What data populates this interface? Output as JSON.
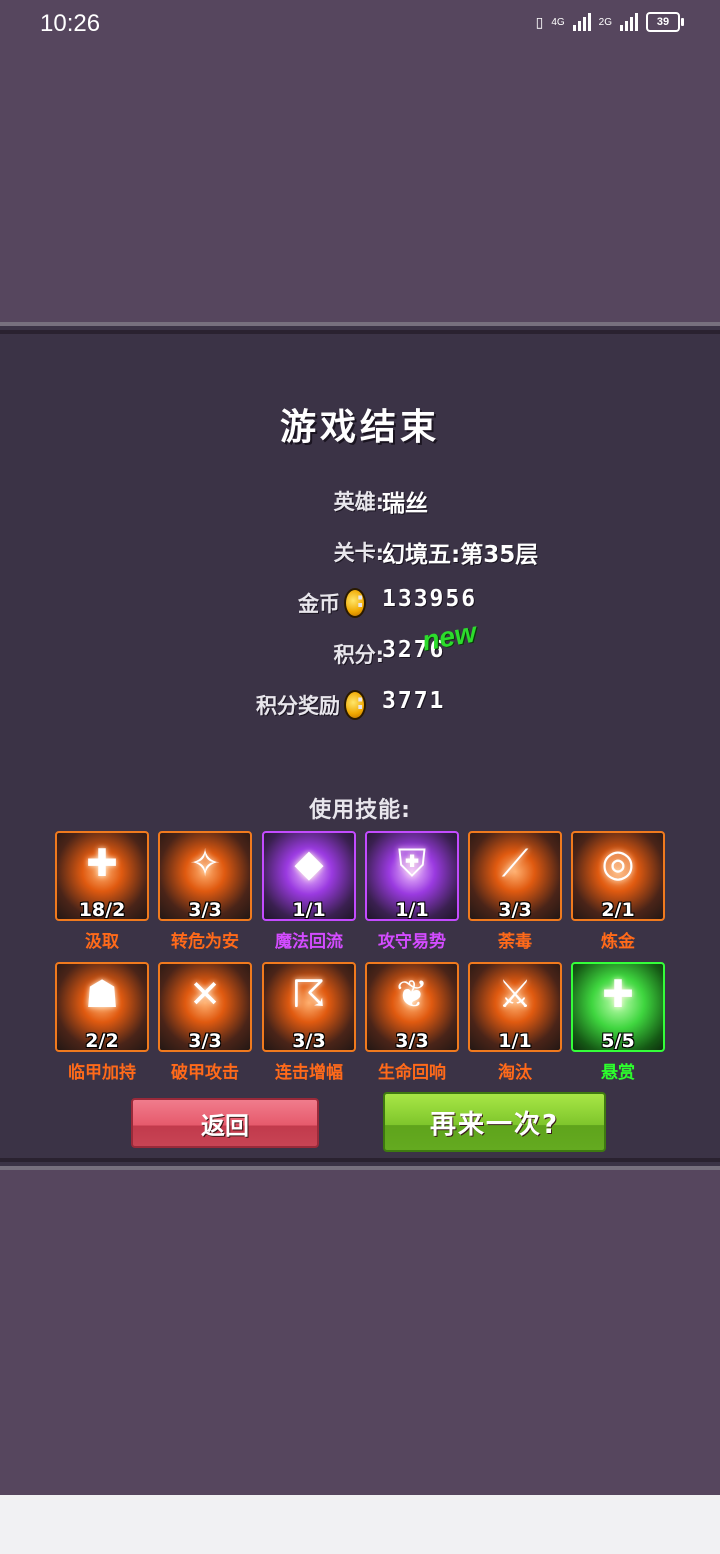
{
  "status_bar": {
    "time": "10:26",
    "net1": "4G",
    "net2": "2G",
    "battery": "39"
  },
  "result": {
    "title": "游戏结束",
    "hero_label": "英雄:",
    "hero_value": "瑞丝",
    "stage_label": "关卡:",
    "stage_value": "幻境五:第35层",
    "gold_label": "金币",
    "gold_value": "133956",
    "score_label": "积分:",
    "score_value": "3276",
    "new_badge": "new",
    "reward_label": "积分奖励",
    "reward_value": "3771",
    "colon": ":"
  },
  "skills": {
    "title": "使用技能:",
    "items": [
      {
        "name": "汲取",
        "count": "18/2",
        "rarity": "orange",
        "glyph": "✚"
      },
      {
        "name": "转危为安",
        "count": "3/3",
        "rarity": "orange",
        "glyph": "✧"
      },
      {
        "name": "魔法回流",
        "count": "1/1",
        "rarity": "purple",
        "glyph": "◆"
      },
      {
        "name": "攻守易势",
        "count": "1/1",
        "rarity": "purple",
        "glyph": "⛨"
      },
      {
        "name": "荼毒",
        "count": "3/3",
        "rarity": "orange",
        "glyph": "⟋"
      },
      {
        "name": "炼金",
        "count": "2/1",
        "rarity": "orange",
        "glyph": "◎"
      },
      {
        "name": "临甲加持",
        "count": "2/2",
        "rarity": "orange",
        "glyph": "☗"
      },
      {
        "name": "破甲攻击",
        "count": "3/3",
        "rarity": "orange",
        "glyph": "✕"
      },
      {
        "name": "连击增幅",
        "count": "3/3",
        "rarity": "orange",
        "glyph": "☈"
      },
      {
        "name": "生命回响",
        "count": "3/3",
        "rarity": "orange",
        "glyph": "❦"
      },
      {
        "name": "淘汰",
        "count": "1/1",
        "rarity": "orange",
        "glyph": "⚔"
      },
      {
        "name": "悬赏",
        "count": "5/5",
        "rarity": "green",
        "glyph": "✚"
      }
    ]
  },
  "buttons": {
    "back": "返回",
    "retry": "再来一次?"
  }
}
